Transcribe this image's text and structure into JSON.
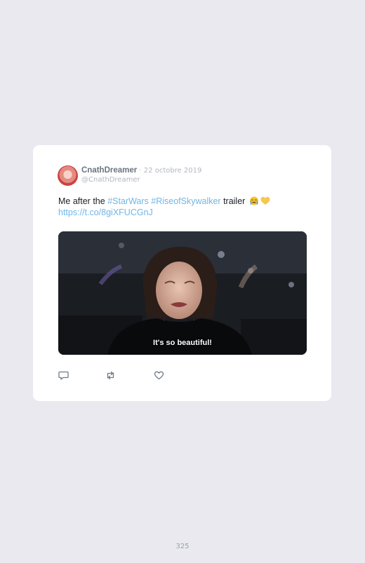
{
  "tweet": {
    "display_name": "CnathDreamer",
    "separator": " · ",
    "date": "22 octobre 2019",
    "handle": "@CnathDreamer",
    "text": {
      "prefix": "Me after the ",
      "hashtag1": "#StarWars",
      "space": " ",
      "hashtag2": "#RiseofSkywalker",
      "suffix": " trailer",
      "link": "https://t.co/8giXFUCGnJ"
    },
    "media": {
      "subtitle": "It's so beautiful!"
    },
    "actions": {
      "reply_icon": "reply-icon",
      "retweet_icon": "retweet-icon",
      "like_icon": "heart-icon"
    }
  },
  "page": {
    "number": "325"
  },
  "colors": {
    "background": "#e9e9ef",
    "card": "#ffffff",
    "link": "#6fb6e6"
  }
}
